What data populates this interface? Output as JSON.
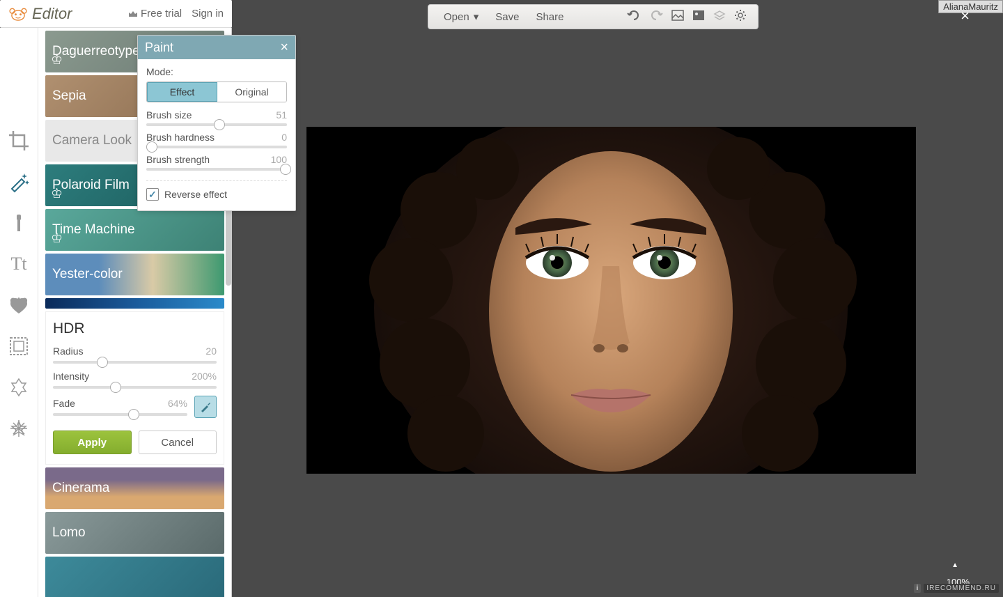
{
  "header": {
    "app_name": "Editor",
    "free_trial": "Free trial",
    "sign_in": "Sign in"
  },
  "toolbar": {
    "open": "Open",
    "save": "Save",
    "share": "Share"
  },
  "rail": {
    "items": [
      "crop",
      "effects",
      "touchup",
      "text",
      "graphics",
      "frames",
      "textures",
      "themes"
    ]
  },
  "effects": {
    "items": [
      {
        "label": "Daguerreotype",
        "premium": true
      },
      {
        "label": "Sepia",
        "premium": false
      },
      {
        "label": "Camera Look",
        "premium": false
      },
      {
        "label": "Polaroid Film",
        "premium": true
      },
      {
        "label": "Time Machine",
        "premium": true
      },
      {
        "label": "Yester-color",
        "premium": false
      },
      {
        "label": "HDR",
        "premium": false
      },
      {
        "label": "Cinerama",
        "premium": false
      },
      {
        "label": "Lomo",
        "premium": false
      }
    ]
  },
  "hdr": {
    "title": "HDR",
    "radius_label": "Radius",
    "radius_value": "20",
    "radius_pct": 27,
    "intensity_label": "Intensity",
    "intensity_value": "200%",
    "intensity_pct": 35,
    "fade_label": "Fade",
    "fade_value": "64%",
    "fade_pct": 50,
    "apply": "Apply",
    "cancel": "Cancel"
  },
  "paint": {
    "title": "Paint",
    "mode_label": "Mode:",
    "mode_effect": "Effect",
    "mode_original": "Original",
    "brush_size_label": "Brush size",
    "brush_size_value": "51",
    "brush_size_pct": 51,
    "brush_hard_label": "Brush hardness",
    "brush_hard_value": "0",
    "brush_hard_pct": 0,
    "brush_str_label": "Brush strength",
    "brush_str_value": "100",
    "brush_str_pct": 100,
    "reverse_label": "Reverse effect",
    "reverse_checked": true
  },
  "overlay": {
    "username": "AlianaMauritz",
    "zoom": "100%",
    "watermark": "IRECOMMEND.RU"
  }
}
